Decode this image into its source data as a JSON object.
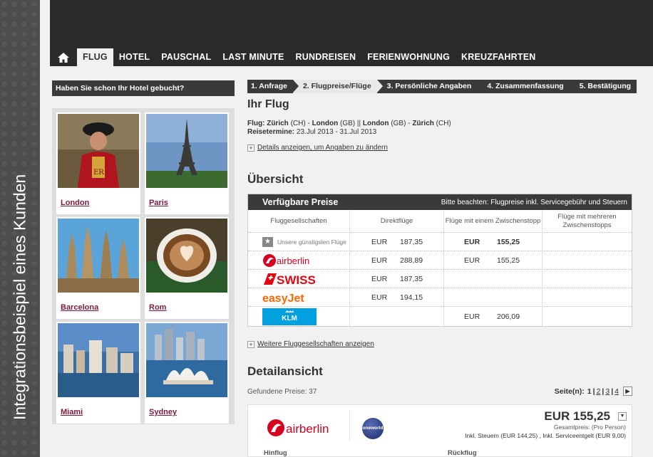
{
  "banner": {
    "text": "Integrationsbeispiel eines Kunden"
  },
  "nav": {
    "items": [
      "Flug",
      "Hotel",
      "Pauschal",
      "Last Minute",
      "Rundreisen",
      "Ferienwohnung",
      "Kreuzfahrten"
    ],
    "active": "Flug"
  },
  "sidebar": {
    "hotel_prompt": "Haben Sie schon Ihr Hotel gebucht?",
    "cities": [
      "London",
      "Paris",
      "Barcelona",
      "Rom",
      "Miami",
      "Sydney"
    ]
  },
  "steps": [
    "1. Anfrage",
    "2. Flugpreise/Flüge",
    "3. Persönliche Angaben",
    "4. Zusammenfassung",
    "5. Bestätigung"
  ],
  "flight": {
    "heading": "Ihr Flug",
    "route_label": "Flug:",
    "route_parts": [
      {
        "city": "Zürich",
        "code": "(CH)"
      },
      {
        "city": "London",
        "code": "(GB)"
      },
      {
        "city": "London",
        "code": "(GB)"
      },
      {
        "city": "Zürich",
        "code": "(CH)"
      }
    ],
    "dates_label": "Reisetermine:",
    "dates": "23.Jul 2013 - 31.Jul 2013",
    "details_link": "Details anzeigen, um Angaben zu ändern"
  },
  "overview": {
    "heading": "Übersicht",
    "table_title": "Verfügbare Preise",
    "table_note": "Bitte beachten: Flugpreise inkl. Servicegebühr und Steuern",
    "columns": [
      "Fluggesellschaften",
      "Direktflüge",
      "Flüge mit einem Zwischenstopp",
      "Flüge mit mehreren Zwischenstopps"
    ],
    "cheapest_label": "Unsere günstigsten Flüge",
    "rows": [
      {
        "airline": "cheapest",
        "direct_cur": "EUR",
        "direct": "187,35",
        "one_cur": "EUR",
        "one": "155,25",
        "multi": ""
      },
      {
        "airline": "airberlin",
        "direct_cur": "EUR",
        "direct": "288,89",
        "one_cur": "EUR",
        "one": "155,25",
        "multi": ""
      },
      {
        "airline": "SWISS",
        "direct_cur": "EUR",
        "direct": "187,35",
        "one_cur": "",
        "one": "",
        "multi": ""
      },
      {
        "airline": "easyJet",
        "direct_cur": "EUR",
        "direct": "194,15",
        "one_cur": "",
        "one": "",
        "multi": ""
      },
      {
        "airline": "KLM",
        "direct_cur": "",
        "direct": "",
        "one_cur": "EUR",
        "one": "206,09",
        "multi": ""
      }
    ],
    "more_link": "Weitere Fluggesellschaften anzeigen"
  },
  "detail": {
    "heading": "Detailansicht",
    "found_label": "Gefundene Preise:",
    "found_count": "37",
    "pages_label": "Seite(n):",
    "pages": [
      "1",
      "2",
      "3",
      "4"
    ],
    "airline": "airberlin",
    "alliance": "oneworld",
    "price": "EUR 155,25",
    "total_label": "Gesamtpreis: (Pro Person)",
    "tax_line": "Inkl. Steuern (EUR 144,25) , Inkl. Serviceentgelt (EUR 9,00)",
    "outbound": "Hinflug",
    "return": "Rückflug"
  },
  "colors": {
    "accent": "#7a1a3a",
    "header": "#2b2b2b",
    "airberlin_red": "#d7001f",
    "swiss_red": "#e30613",
    "easyjet_orange": "#ff6600",
    "klm_blue": "#00a1de"
  }
}
